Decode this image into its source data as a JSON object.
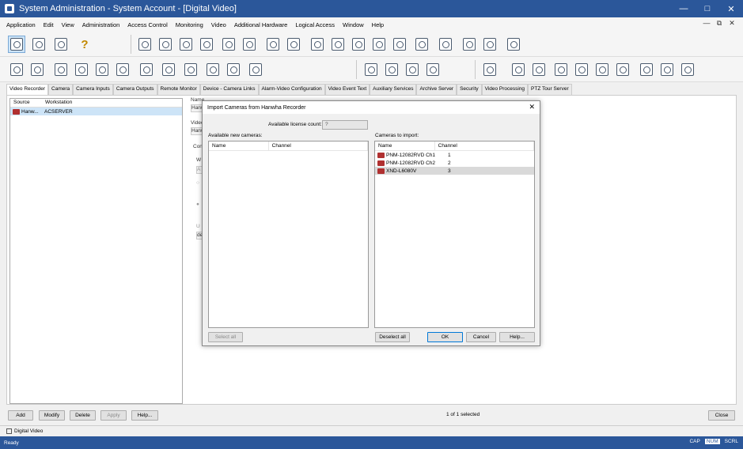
{
  "window": {
    "title": "System Administration - System Account - [Digital Video]"
  },
  "menu": [
    "Application",
    "Edit",
    "View",
    "Administration",
    "Access Control",
    "Monitoring",
    "Video",
    "Additional Hardware",
    "Logical Access",
    "Window",
    "Help"
  ],
  "tabs": [
    "Video Recorder",
    "Camera",
    "Camera Inputs",
    "Camera Outputs",
    "Remote Monitor",
    "Device - Camera Links",
    "Alarm-Video Configuration",
    "Video Event Text",
    "Auxiliary Services",
    "Archive Server",
    "Security",
    "Video Processing",
    "PTZ Tour Server"
  ],
  "left_list": {
    "columns": [
      "Source",
      "Workstation"
    ],
    "rows": [
      {
        "source": "Hanw...",
        "workstation": "ACSERVER"
      }
    ]
  },
  "background_fragments": {
    "name_label": "Name",
    "name_value": "Hanw",
    "video_label": "Video",
    "video_value": "Hanw",
    "conn_label": "Con",
    "w_label": "W",
    "a_label": "A",
    "u_label": "U",
    "de_label": "de"
  },
  "dialog": {
    "title": "Import Cameras from Hanwha Recorder",
    "license_label": "Available license count:",
    "license_value": "?",
    "available_label": "Available new cameras:",
    "import_label": "Cameras to import:",
    "columns": {
      "name": "Name",
      "channel": "Channel"
    },
    "cameras_to_import": [
      {
        "name": "PNM-12082RVD Ch1",
        "channel": "1"
      },
      {
        "name": "PNM-12082RVD Ch2",
        "channel": "2"
      },
      {
        "name": "XND-L6080V",
        "channel": "3"
      }
    ],
    "buttons": {
      "select_all": "Select all",
      "deselect_all": "Deselect all",
      "ok": "OK",
      "cancel": "Cancel",
      "help": "Help..."
    }
  },
  "bottom": {
    "add": "Add",
    "modify": "Modify",
    "delete": "Delete",
    "apply": "Apply",
    "help": "Help...",
    "selection": "1 of 1 selected",
    "close": "Close"
  },
  "doc_tab": "Digital Video",
  "status": {
    "text": "Ready",
    "indicators": [
      "CAP",
      "NUM",
      "SCRL"
    ]
  }
}
